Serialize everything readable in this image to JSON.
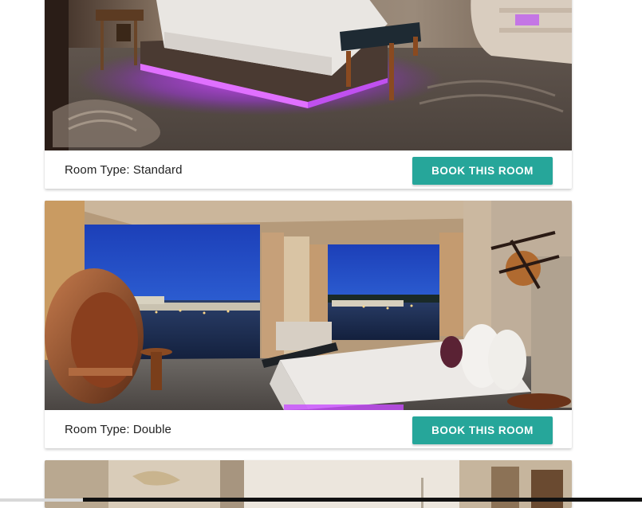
{
  "theme": {
    "accent": "#26a69a"
  },
  "rooms": [
    {
      "room_type_label": "Room Type: Standard",
      "book_label": "BOOK THIS ROOM",
      "photo": "hotel-room-purple-led-bed-photo"
    },
    {
      "room_type_label": "Room Type: Double",
      "book_label": "BOOK THIS ROOM",
      "photo": "hotel-room-marina-view-egg-chair-photo"
    },
    {
      "photo": "hotel-room-partial-photo"
    }
  ]
}
